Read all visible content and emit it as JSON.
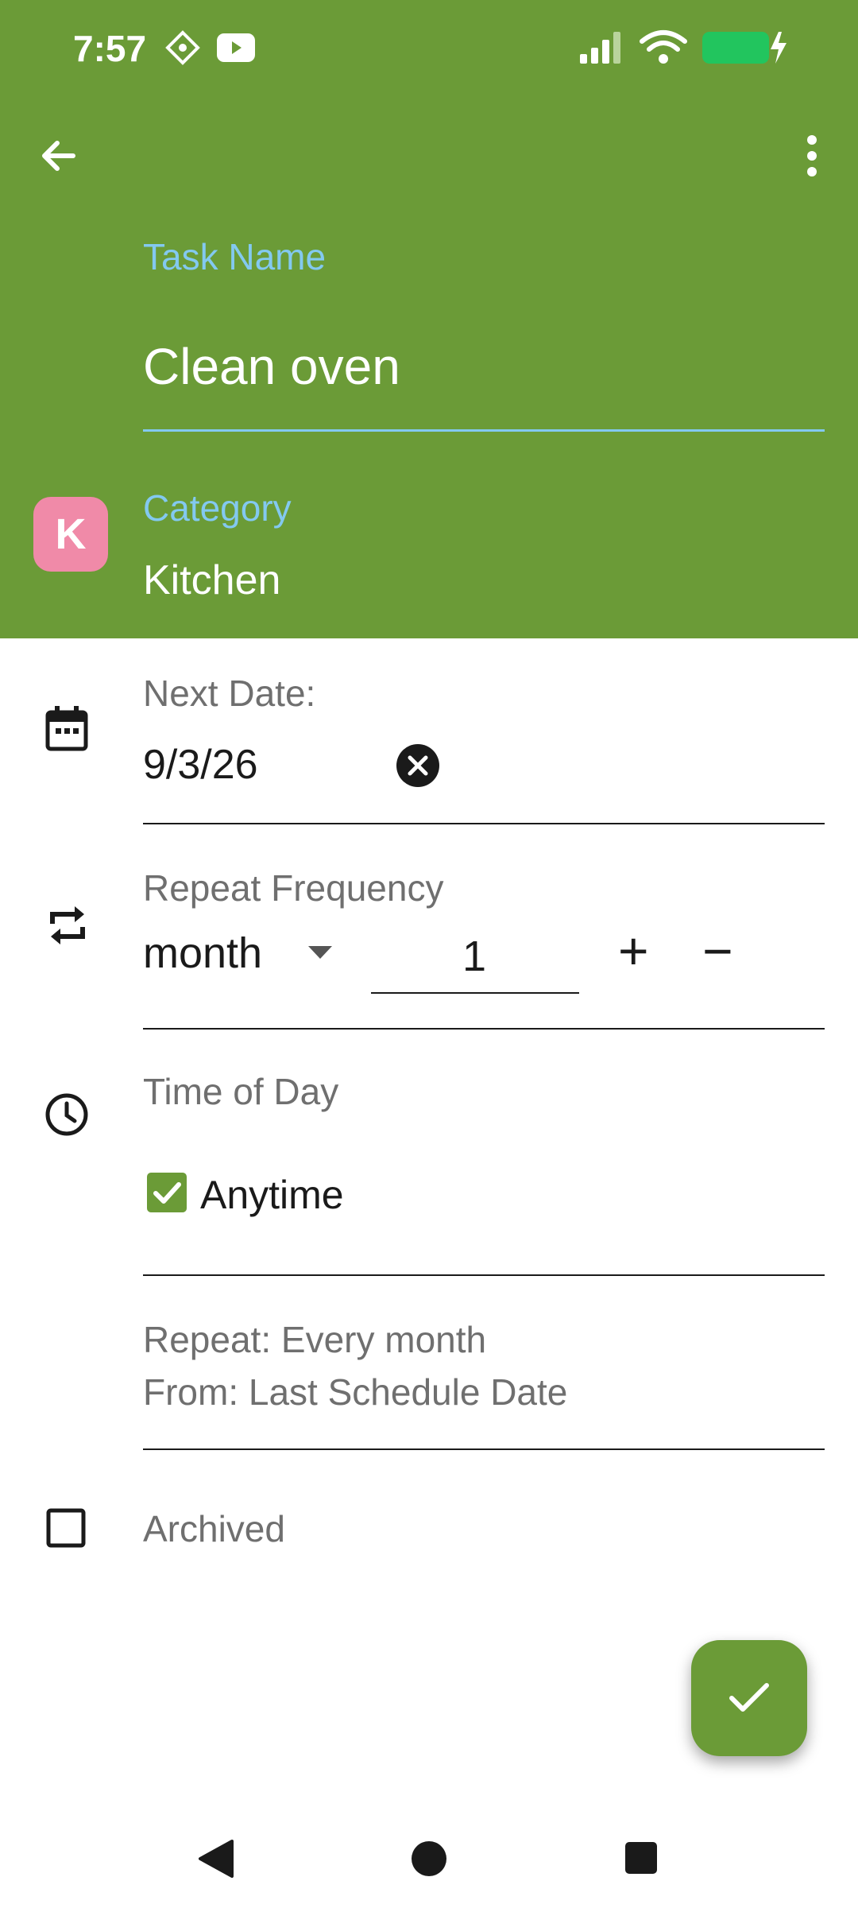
{
  "status_bar": {
    "time": "7:57"
  },
  "header": {
    "task_name_label": "Task Name",
    "task_name_value": "Clean oven",
    "category_label": "Category",
    "category_value": "Kitchen",
    "category_avatar_letter": "K"
  },
  "next_date": {
    "label": "Next Date:",
    "value": "9/3/26"
  },
  "repeat_frequency": {
    "label": "Repeat Frequency",
    "unit": "month",
    "count": "1",
    "plus": "+",
    "minus": "−"
  },
  "time_of_day": {
    "label": "Time of Day",
    "anytime_label": "Anytime",
    "anytime_checked": true
  },
  "summary": {
    "repeat_line": "Repeat: Every month",
    "from_line": "From: Last Schedule Date"
  },
  "archived": {
    "label": "Archived",
    "checked": false
  },
  "colors": {
    "header_bg": "#6b9b37",
    "accent_blue": "#83c9f0",
    "avatar_pink": "#f08aa8",
    "checkbox_green": "#6b9b37"
  }
}
